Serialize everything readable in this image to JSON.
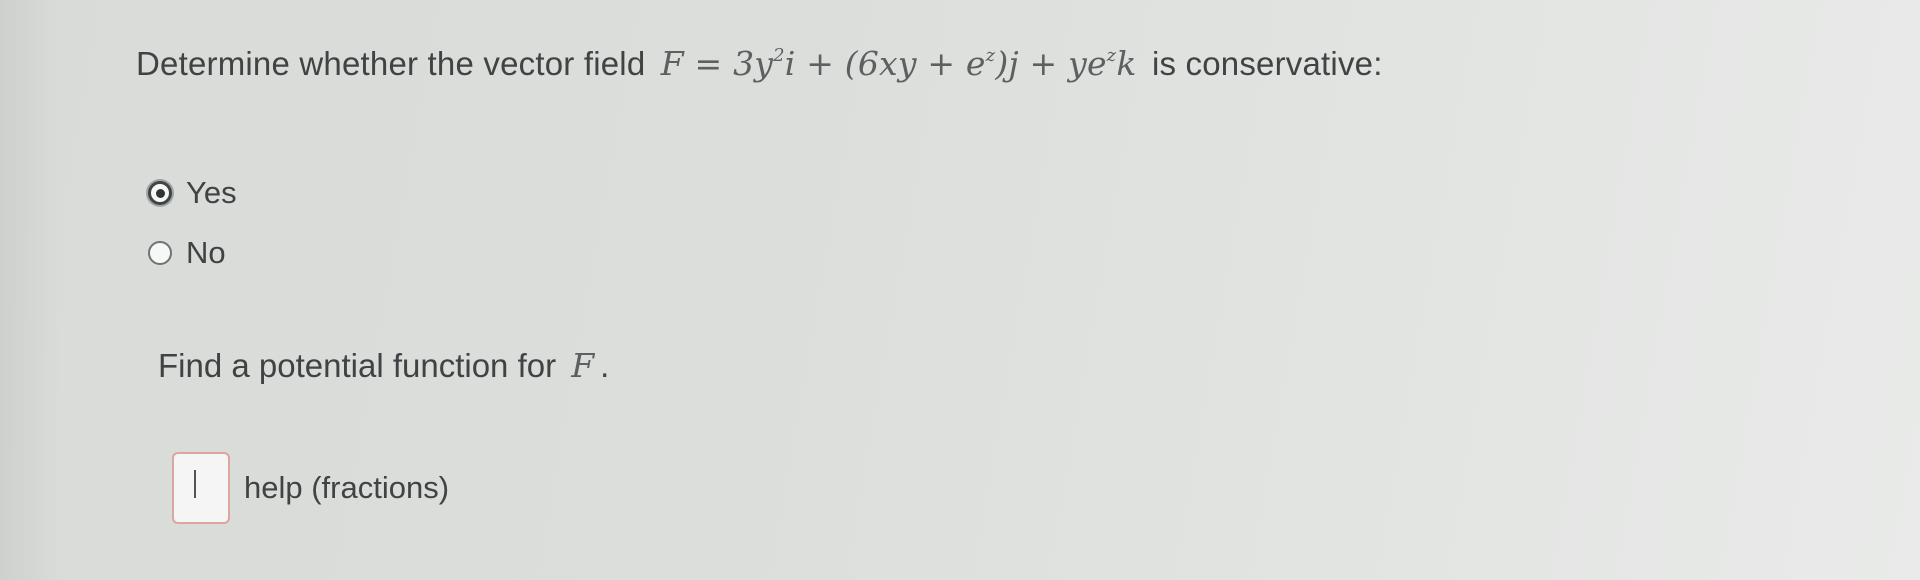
{
  "question": {
    "prefix": "Determine whether the vector field",
    "formula": {
      "lhs": "F",
      "eq": " = ",
      "t1": "3y",
      "t1_sup": "2",
      "t2": "i + (6xy + e",
      "t2_sup": "z",
      "t3": ")j + ye",
      "t3_sup": "z",
      "t4": "k"
    },
    "suffix": "is conservative:"
  },
  "options": [
    {
      "label": "Yes",
      "selected": true
    },
    {
      "label": "No",
      "selected": false
    }
  ],
  "potential": {
    "prefix": "Find a potential function for",
    "symbol": "F",
    "suffix": "."
  },
  "answer": {
    "value": "",
    "help_text": "help (fractions)"
  },
  "colors": {
    "background": "#dcdedc",
    "text": "#3f4343",
    "input_border": "#d9a6a0"
  }
}
